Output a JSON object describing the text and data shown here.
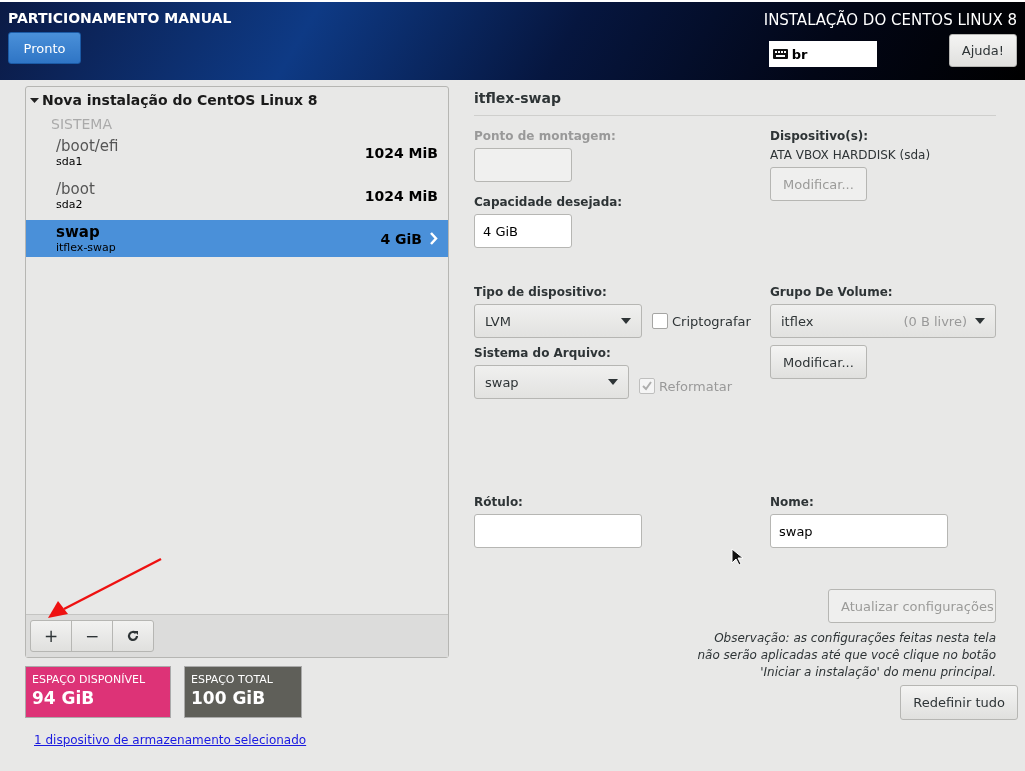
{
  "header": {
    "title": "PARTICIONAMENTO MANUAL",
    "done_button": "Pronto",
    "product_title": "INSTALAÇÃO DO CENTOS LINUX 8",
    "keyboard_layout": "br",
    "help_button": "Ajuda!"
  },
  "tree": {
    "title": "Nova instalação do CentOS Linux 8",
    "expanded": true,
    "sections": [
      {
        "name": "SISTEMA",
        "items": [
          {
            "mount": "/boot/efi",
            "device": "sda1",
            "size": "1024 MiB",
            "selected": false
          },
          {
            "mount": "/boot",
            "device": "sda2",
            "size": "1024 MiB",
            "selected": false
          },
          {
            "mount": "swap",
            "device": "itflex-swap",
            "size": "4 GiB",
            "selected": true
          }
        ]
      }
    ]
  },
  "toolbar": [
    {
      "kind": "add",
      "label": "+"
    },
    {
      "kind": "remove",
      "label": "−"
    },
    {
      "kind": "refresh"
    }
  ],
  "space": [
    {
      "label": "ESPAÇO DISPONÍVEL",
      "value": "94 GiB",
      "color": "#dd3377"
    },
    {
      "label": "ESPAÇO TOTAL",
      "value": "100 GiB",
      "color": "#5f5f59"
    }
  ],
  "storage_link": "1 dispositivo de armazenamento selecionado",
  "details": {
    "title": "itflex-swap",
    "mount_point": {
      "label": "Ponto de montagem:",
      "disabled": true
    },
    "capacity": {
      "label": "Capacidade desejada:",
      "value": "4 GiB",
      "disabled": false
    },
    "devices": {
      "label": "Dispositivo(s):",
      "value": "ATA VBOX HARDDISK (sda)",
      "button": "Modificar...",
      "disabled": true
    },
    "device_type": {
      "label": "Tipo de dispositivo:",
      "value": "LVM"
    },
    "encrypt": {
      "label": "Criptografar",
      "checked": false,
      "disabled": false
    },
    "file_system": {
      "label": "Sistema do Arquivo:",
      "value": "swap"
    },
    "reformat": {
      "label": "Reformatar",
      "checked": true,
      "disabled": true
    },
    "volume_group": {
      "label": "Grupo De Volume:",
      "value": "itflex",
      "free": "(0 B livre)",
      "button": "Modificar..."
    },
    "label_field": {
      "label": "Rótulo:"
    },
    "name_field": {
      "label": "Nome:",
      "value": "swap"
    },
    "update_button": {
      "label": "Atualizar configurações",
      "disabled": true
    },
    "note": "*Observação:*  *as configurações feitas nesta tela não serão aplicadas até que você clique no botão 'Iniciar a instalação' do menu principal.*"
  },
  "reset_button": "Redefinir tudo"
}
